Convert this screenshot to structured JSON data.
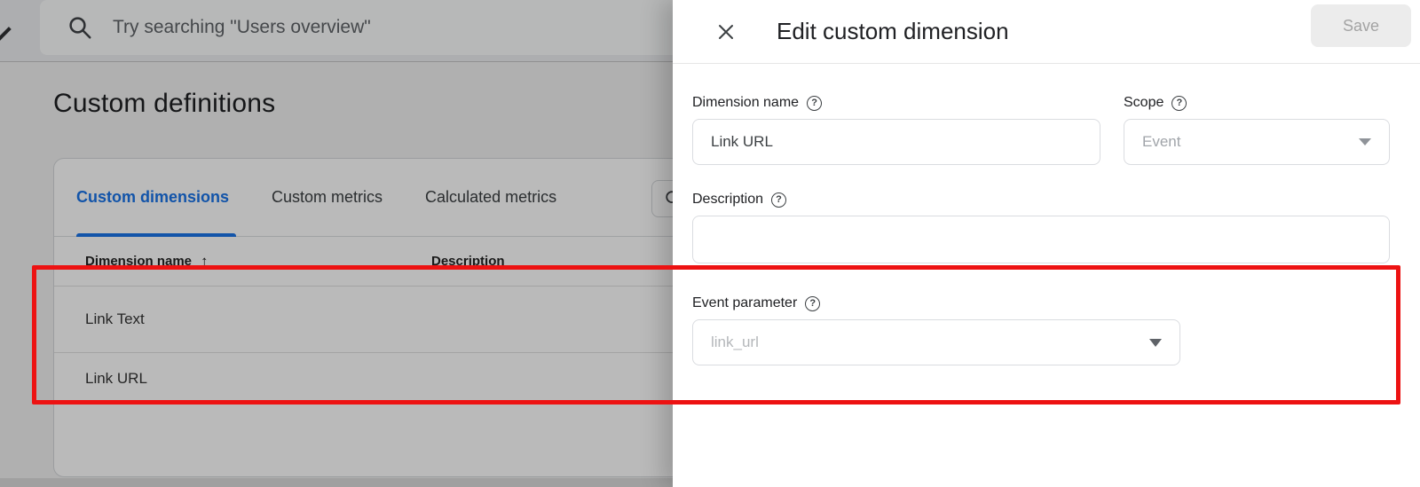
{
  "topbar": {
    "search_placeholder": "Try searching \"Users overview\""
  },
  "page": {
    "title": "Custom definitions",
    "tabs": [
      {
        "label": "Custom dimensions",
        "active": true
      },
      {
        "label": "Custom metrics",
        "active": false
      },
      {
        "label": "Calculated metrics",
        "active": false
      }
    ],
    "table": {
      "columns": [
        "Dimension name",
        "Description"
      ],
      "sort": {
        "column": "Dimension name",
        "direction": "ascending",
        "icon": "up-arrow"
      },
      "rows": [
        {
          "dimension_name": "Link Text",
          "description": ""
        },
        {
          "dimension_name": "Link URL",
          "description": ""
        }
      ]
    }
  },
  "panel": {
    "title": "Edit custom dimension",
    "save_label": "Save",
    "save_enabled": false,
    "fields": {
      "dimension_name": {
        "label": "Dimension name",
        "value": "Link URL"
      },
      "scope": {
        "label": "Scope",
        "value": "Event",
        "disabled": true
      },
      "description": {
        "label": "Description",
        "value": ""
      },
      "event_parameter": {
        "label": "Event parameter",
        "value": "link_url"
      }
    }
  },
  "annotation": {
    "shape": "rectangle",
    "color": "#ed1212"
  },
  "colors": {
    "accent_blue": "#1a73e8",
    "annotation_red": "#ed1212",
    "disabled_text": "#9aa0a6",
    "panel_bg": "#ffffff"
  }
}
